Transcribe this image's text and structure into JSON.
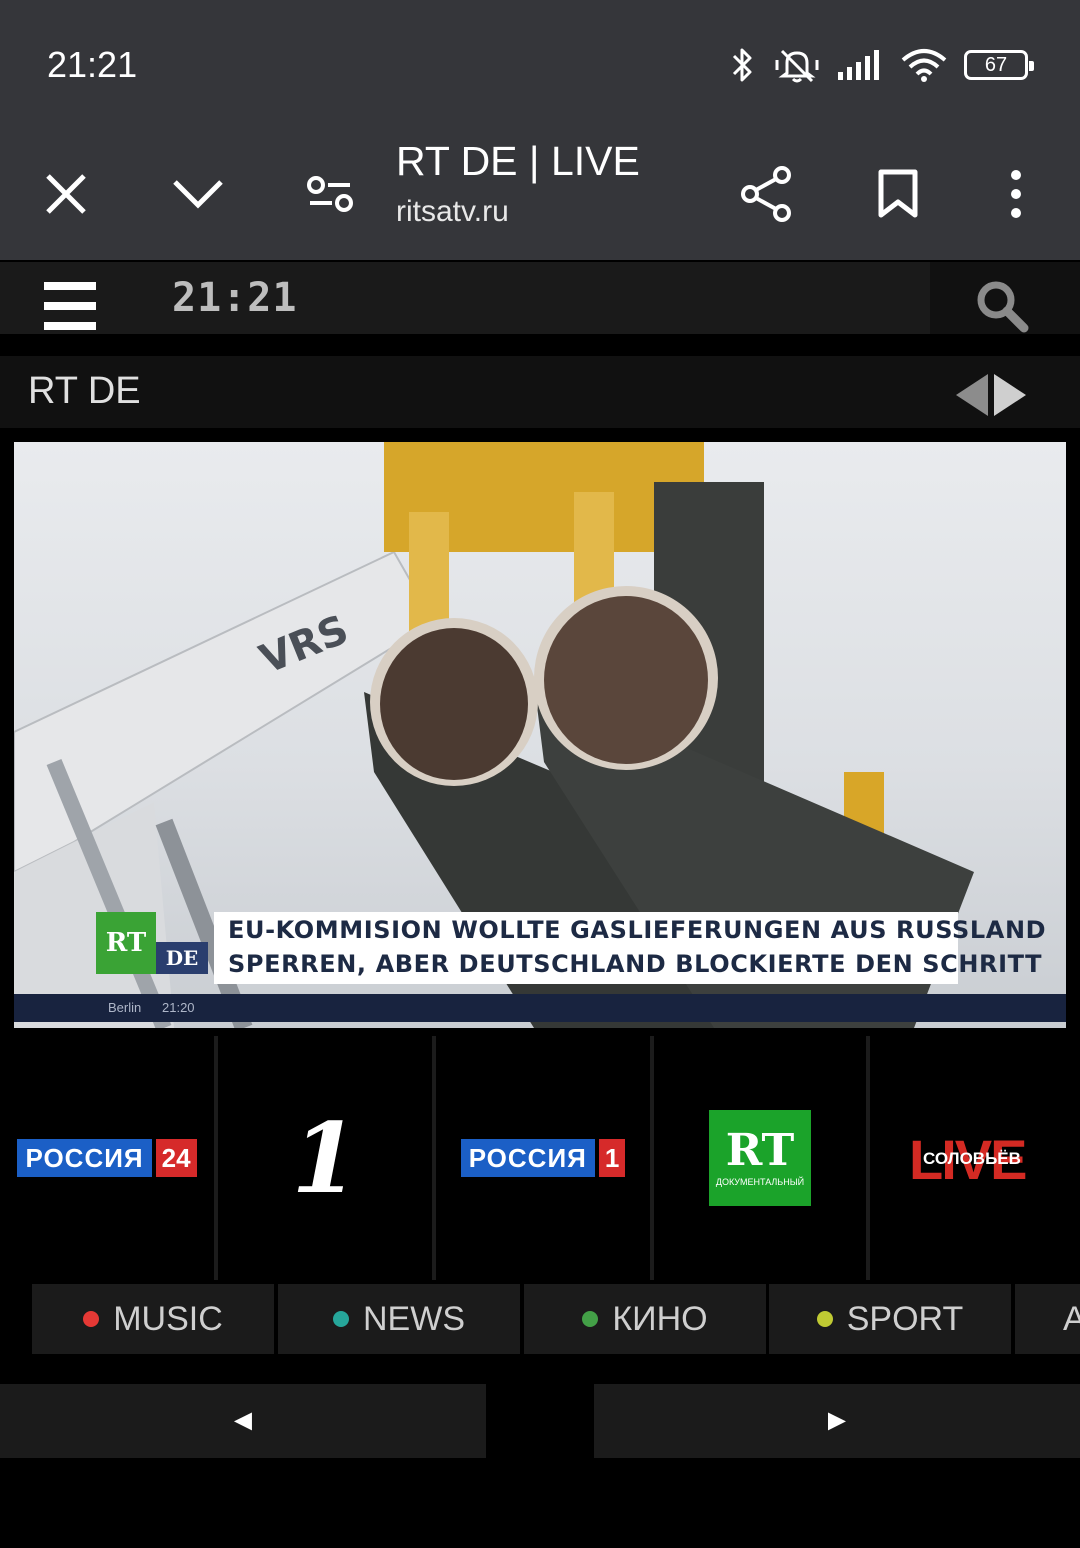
{
  "status": {
    "time": "21:21",
    "battery": "67"
  },
  "toolbar": {
    "title": "RT DE | LIVE",
    "url": "ritsatv.ru"
  },
  "header": {
    "clock": "21:21"
  },
  "channel": {
    "name": "RT DE"
  },
  "video": {
    "crane_label": "VRS",
    "ticker_logo": "RT",
    "ticker_logo_sub": "DE",
    "ticker_line1": "EU-KOMMISION WOLLTE GASLIEFERUNGEN AUS RUSSLAND",
    "ticker_line2": "SPERREN, ABER DEUTSCHLAND BLOCKIERTE DEN SCHRITT",
    "ticker_location": "Berlin",
    "ticker_time": "21:20"
  },
  "tiles": [
    {
      "name": "россия-24",
      "main": "РОССИЯ",
      "badge": "24"
    },
    {
      "name": "perviy",
      "glyph": "1"
    },
    {
      "name": "россия-1",
      "main": "РОССИЯ",
      "badge": "1"
    },
    {
      "name": "rt-doc",
      "main": "RT",
      "sub": "ДОКУМЕНТАЛЬНЫЙ"
    },
    {
      "name": "soloviev-live",
      "main": "LIVE",
      "sub": "СОЛОВЬЁВ"
    }
  ],
  "categories": [
    {
      "label": "MUSIC",
      "color": "#e53935"
    },
    {
      "label": "NEWS",
      "color": "#26a69a"
    },
    {
      "label": "КИНО",
      "color": "#43a047"
    },
    {
      "label": "SPORT",
      "color": "#c0ca33"
    },
    {
      "label": "A",
      "color": "#43a047"
    }
  ],
  "pager": {
    "prev": "◄",
    "next": "►"
  }
}
